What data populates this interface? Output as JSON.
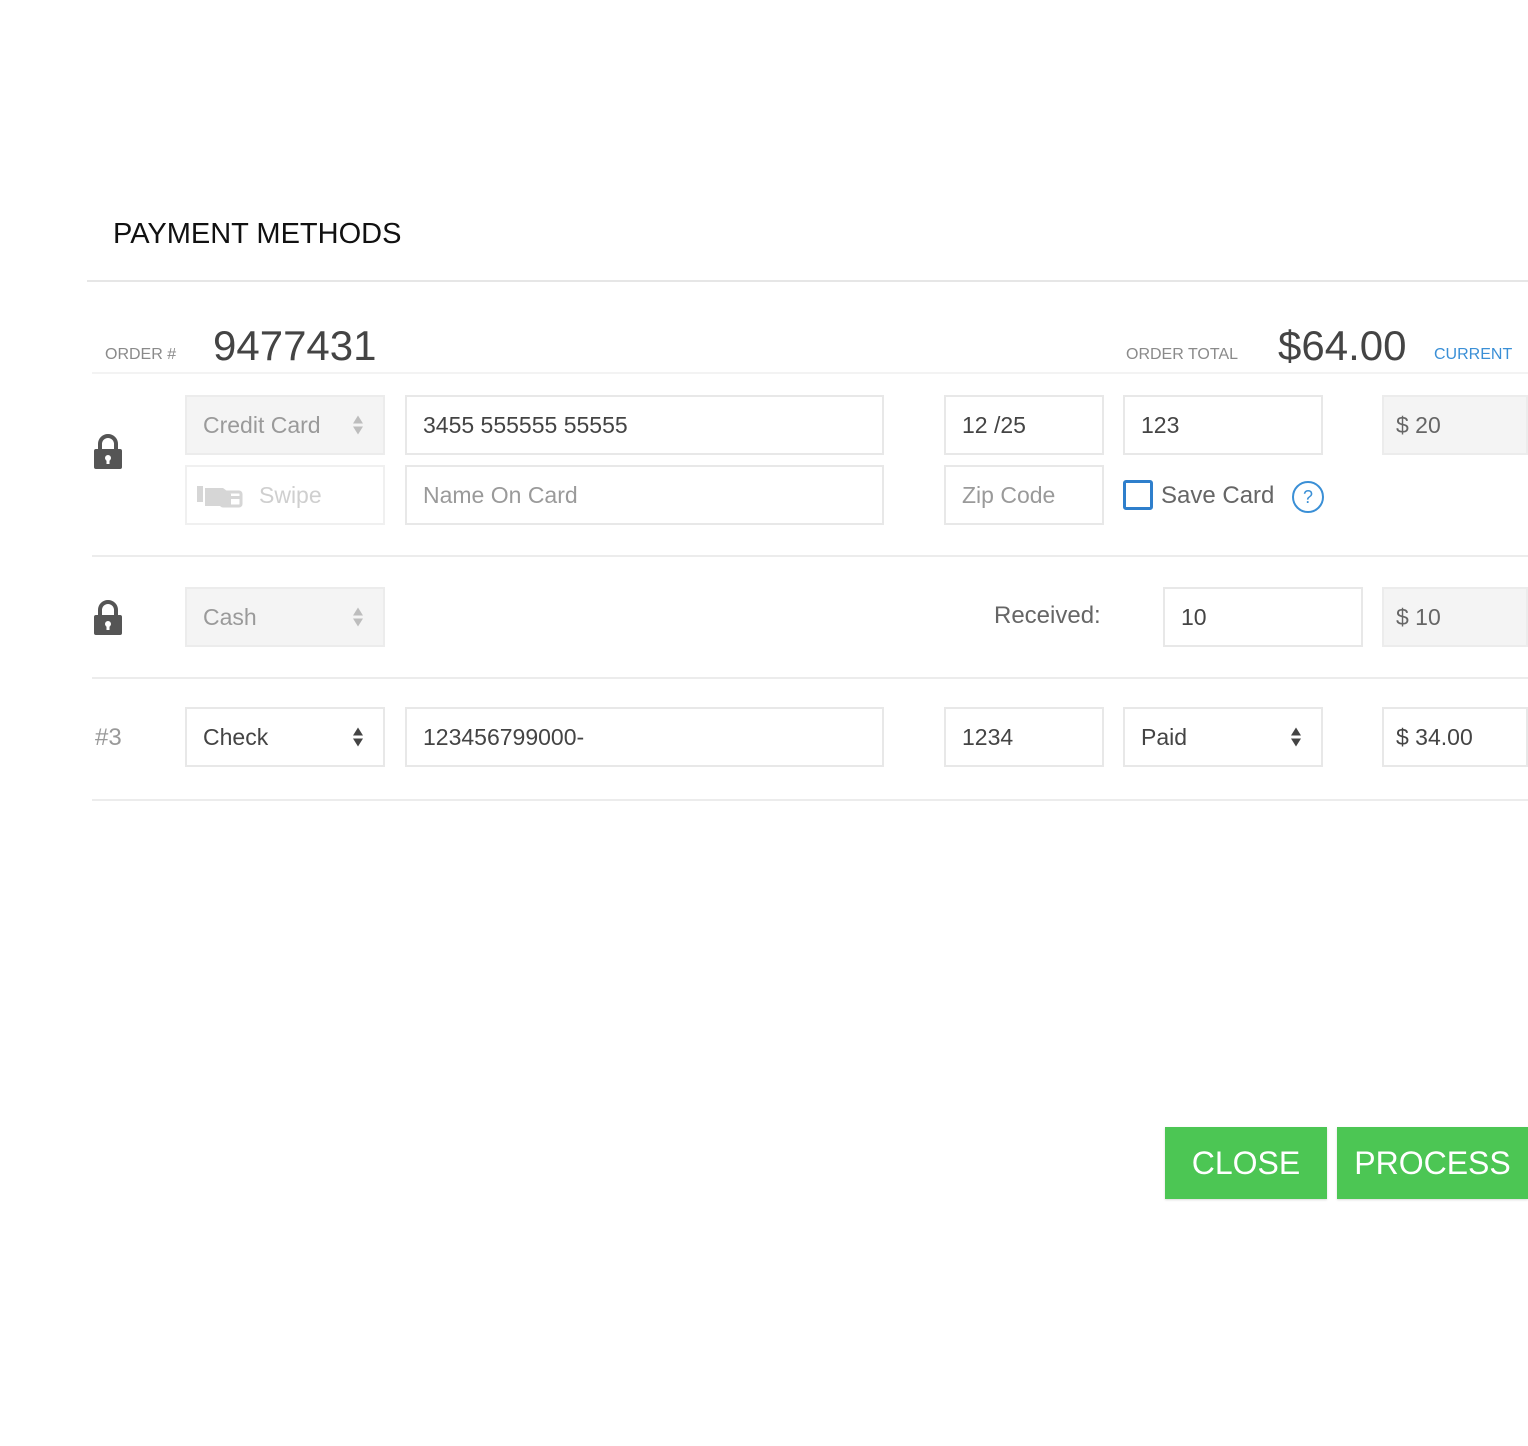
{
  "modal": {
    "title": "PAYMENT METHODS"
  },
  "order": {
    "number_label": "ORDER #",
    "number": "9477431",
    "total_label": "ORDER TOTAL",
    "total": "$64.00",
    "current_link": "CURRENT"
  },
  "payments": [
    {
      "method": "Credit Card",
      "card_number": "3455 555555 55555",
      "expiry": "12 /25",
      "cvv": "123",
      "amount": "$ 20",
      "swipe_label": "Swipe",
      "name_placeholder": "Name On Card",
      "zip_placeholder": "Zip Code",
      "save_card_label": "Save Card",
      "help_glyph": "?",
      "icon": "lock-icon"
    },
    {
      "method": "Cash",
      "received_label": "Received:",
      "received": "10",
      "amount": "$ 10",
      "icon": "lock-icon"
    },
    {
      "row_label": "#3",
      "method": "Check",
      "check_number": "123456799000-",
      "code": "1234",
      "status": "Paid",
      "amount": "$ 34.00"
    }
  ],
  "buttons": {
    "close": "CLOSE",
    "process": "PROCESS"
  },
  "colors": {
    "accent_green": "#4cc654",
    "link_blue": "#3a8fd6"
  }
}
